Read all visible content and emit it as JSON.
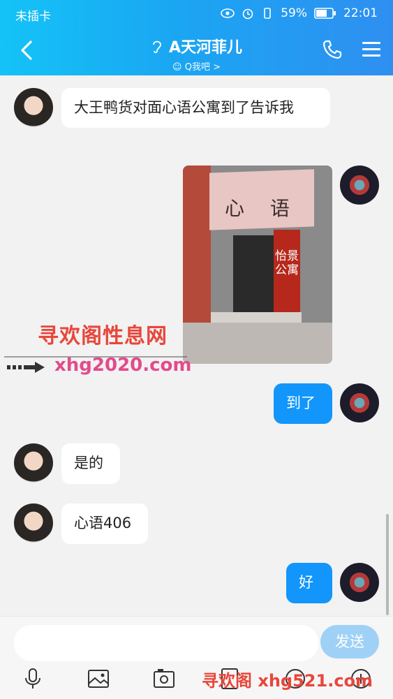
{
  "status": {
    "carrier": "未插卡",
    "battery": "59%",
    "time": "22:01"
  },
  "header": {
    "name": "A天河菲儿",
    "subtitle": "Q我吧 >"
  },
  "messages": [
    {
      "side": "left",
      "text": "大王鸭货对面心语公寓到了告诉我"
    },
    {
      "side": "right",
      "type": "image",
      "sign": "心 语",
      "banner": "怡景公寓"
    },
    {
      "side": "right",
      "text": "到了"
    },
    {
      "side": "left",
      "text": "是的"
    },
    {
      "side": "left",
      "text": "心语406"
    },
    {
      "side": "right",
      "text": "好"
    }
  ],
  "watermarks": {
    "top": "寻欢阁性息网",
    "url": "xhg2020.com",
    "bottom": "寻欢阁 xhg521.com"
  },
  "input": {
    "placeholder": "",
    "send_label": "发送"
  },
  "colors": {
    "header_start": "#14c3f7",
    "header_end": "#2f8ff1",
    "bubble_blue": "#1296fb",
    "send_button": "#9fd1f7"
  }
}
